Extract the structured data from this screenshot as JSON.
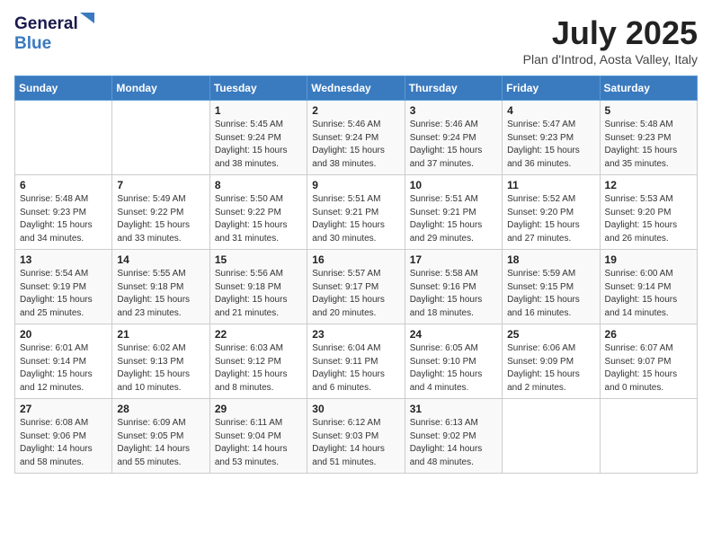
{
  "logo": {
    "line1": "General",
    "line2": "Blue"
  },
  "title": "July 2025",
  "location": "Plan d'Introd, Aosta Valley, Italy",
  "weekdays": [
    "Sunday",
    "Monday",
    "Tuesday",
    "Wednesday",
    "Thursday",
    "Friday",
    "Saturday"
  ],
  "weeks": [
    [
      {
        "day": "",
        "info": ""
      },
      {
        "day": "",
        "info": ""
      },
      {
        "day": "1",
        "info": "Sunrise: 5:45 AM\nSunset: 9:24 PM\nDaylight: 15 hours\nand 38 minutes."
      },
      {
        "day": "2",
        "info": "Sunrise: 5:46 AM\nSunset: 9:24 PM\nDaylight: 15 hours\nand 38 minutes."
      },
      {
        "day": "3",
        "info": "Sunrise: 5:46 AM\nSunset: 9:24 PM\nDaylight: 15 hours\nand 37 minutes."
      },
      {
        "day": "4",
        "info": "Sunrise: 5:47 AM\nSunset: 9:23 PM\nDaylight: 15 hours\nand 36 minutes."
      },
      {
        "day": "5",
        "info": "Sunrise: 5:48 AM\nSunset: 9:23 PM\nDaylight: 15 hours\nand 35 minutes."
      }
    ],
    [
      {
        "day": "6",
        "info": "Sunrise: 5:48 AM\nSunset: 9:23 PM\nDaylight: 15 hours\nand 34 minutes."
      },
      {
        "day": "7",
        "info": "Sunrise: 5:49 AM\nSunset: 9:22 PM\nDaylight: 15 hours\nand 33 minutes."
      },
      {
        "day": "8",
        "info": "Sunrise: 5:50 AM\nSunset: 9:22 PM\nDaylight: 15 hours\nand 31 minutes."
      },
      {
        "day": "9",
        "info": "Sunrise: 5:51 AM\nSunset: 9:21 PM\nDaylight: 15 hours\nand 30 minutes."
      },
      {
        "day": "10",
        "info": "Sunrise: 5:51 AM\nSunset: 9:21 PM\nDaylight: 15 hours\nand 29 minutes."
      },
      {
        "day": "11",
        "info": "Sunrise: 5:52 AM\nSunset: 9:20 PM\nDaylight: 15 hours\nand 27 minutes."
      },
      {
        "day": "12",
        "info": "Sunrise: 5:53 AM\nSunset: 9:20 PM\nDaylight: 15 hours\nand 26 minutes."
      }
    ],
    [
      {
        "day": "13",
        "info": "Sunrise: 5:54 AM\nSunset: 9:19 PM\nDaylight: 15 hours\nand 25 minutes."
      },
      {
        "day": "14",
        "info": "Sunrise: 5:55 AM\nSunset: 9:18 PM\nDaylight: 15 hours\nand 23 minutes."
      },
      {
        "day": "15",
        "info": "Sunrise: 5:56 AM\nSunset: 9:18 PM\nDaylight: 15 hours\nand 21 minutes."
      },
      {
        "day": "16",
        "info": "Sunrise: 5:57 AM\nSunset: 9:17 PM\nDaylight: 15 hours\nand 20 minutes."
      },
      {
        "day": "17",
        "info": "Sunrise: 5:58 AM\nSunset: 9:16 PM\nDaylight: 15 hours\nand 18 minutes."
      },
      {
        "day": "18",
        "info": "Sunrise: 5:59 AM\nSunset: 9:15 PM\nDaylight: 15 hours\nand 16 minutes."
      },
      {
        "day": "19",
        "info": "Sunrise: 6:00 AM\nSunset: 9:14 PM\nDaylight: 15 hours\nand 14 minutes."
      }
    ],
    [
      {
        "day": "20",
        "info": "Sunrise: 6:01 AM\nSunset: 9:14 PM\nDaylight: 15 hours\nand 12 minutes."
      },
      {
        "day": "21",
        "info": "Sunrise: 6:02 AM\nSunset: 9:13 PM\nDaylight: 15 hours\nand 10 minutes."
      },
      {
        "day": "22",
        "info": "Sunrise: 6:03 AM\nSunset: 9:12 PM\nDaylight: 15 hours\nand 8 minutes."
      },
      {
        "day": "23",
        "info": "Sunrise: 6:04 AM\nSunset: 9:11 PM\nDaylight: 15 hours\nand 6 minutes."
      },
      {
        "day": "24",
        "info": "Sunrise: 6:05 AM\nSunset: 9:10 PM\nDaylight: 15 hours\nand 4 minutes."
      },
      {
        "day": "25",
        "info": "Sunrise: 6:06 AM\nSunset: 9:09 PM\nDaylight: 15 hours\nand 2 minutes."
      },
      {
        "day": "26",
        "info": "Sunrise: 6:07 AM\nSunset: 9:07 PM\nDaylight: 15 hours\nand 0 minutes."
      }
    ],
    [
      {
        "day": "27",
        "info": "Sunrise: 6:08 AM\nSunset: 9:06 PM\nDaylight: 14 hours\nand 58 minutes."
      },
      {
        "day": "28",
        "info": "Sunrise: 6:09 AM\nSunset: 9:05 PM\nDaylight: 14 hours\nand 55 minutes."
      },
      {
        "day": "29",
        "info": "Sunrise: 6:11 AM\nSunset: 9:04 PM\nDaylight: 14 hours\nand 53 minutes."
      },
      {
        "day": "30",
        "info": "Sunrise: 6:12 AM\nSunset: 9:03 PM\nDaylight: 14 hours\nand 51 minutes."
      },
      {
        "day": "31",
        "info": "Sunrise: 6:13 AM\nSunset: 9:02 PM\nDaylight: 14 hours\nand 48 minutes."
      },
      {
        "day": "",
        "info": ""
      },
      {
        "day": "",
        "info": ""
      }
    ]
  ]
}
